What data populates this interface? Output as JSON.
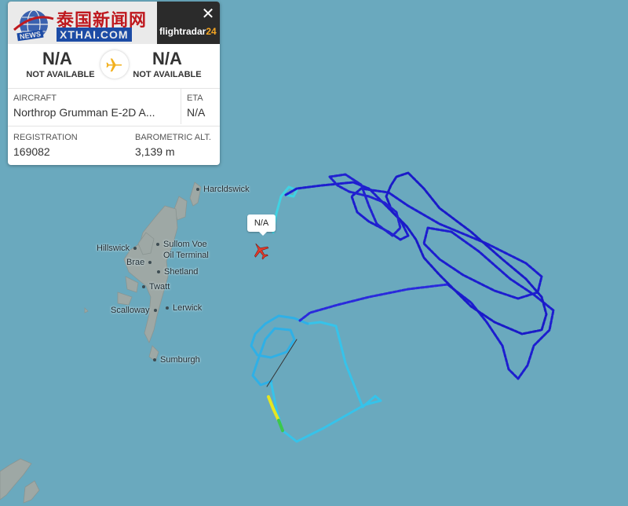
{
  "map": {
    "places": [
      {
        "id": "harcldswick",
        "label": "Harcldswick"
      },
      {
        "id": "hillswick",
        "label": "Hillswick"
      },
      {
        "id": "sullom-voe",
        "label": "Sullom Voe"
      },
      {
        "id": "oil-terminal",
        "label": "Oil Terminal"
      },
      {
        "id": "brae",
        "label": "Brae"
      },
      {
        "id": "shetland",
        "label": "Shetland"
      },
      {
        "id": "twatt",
        "label": "Twatt"
      },
      {
        "id": "scalloway",
        "label": "Scalloway"
      },
      {
        "id": "lerwick",
        "label": "Lerwick"
      },
      {
        "id": "sumburgh",
        "label": "Sumburgh"
      }
    ],
    "aircraft_tag": "N/A",
    "colors": {
      "sea": "#6aa9be",
      "land": "#9aa9a6",
      "track_high": "#1a1ad6",
      "track_low": "#2db6e8"
    }
  },
  "watermark": {
    "cn_text": "泰国新闻网",
    "site": "XTHAI.COM",
    "news": "NEWS"
  },
  "card": {
    "brand": "flightradar",
    "brand_num": "24",
    "origin_code": "N/A",
    "origin_sub": "NOT AVAILABLE",
    "dest_code": "N/A",
    "dest_sub": "NOT AVAILABLE",
    "aircraft_label": "AIRCRAFT",
    "aircraft_value": "Northrop Grumman E-2D A...",
    "eta_label": "ETA",
    "eta_value": "N/A",
    "registration_label": "REGISTRATION",
    "registration_value": "169082",
    "baro_label": "BAROMETRIC ALT.",
    "baro_value": "3,139 m",
    "icons": [
      "close-icon",
      "airplane-icon"
    ]
  }
}
